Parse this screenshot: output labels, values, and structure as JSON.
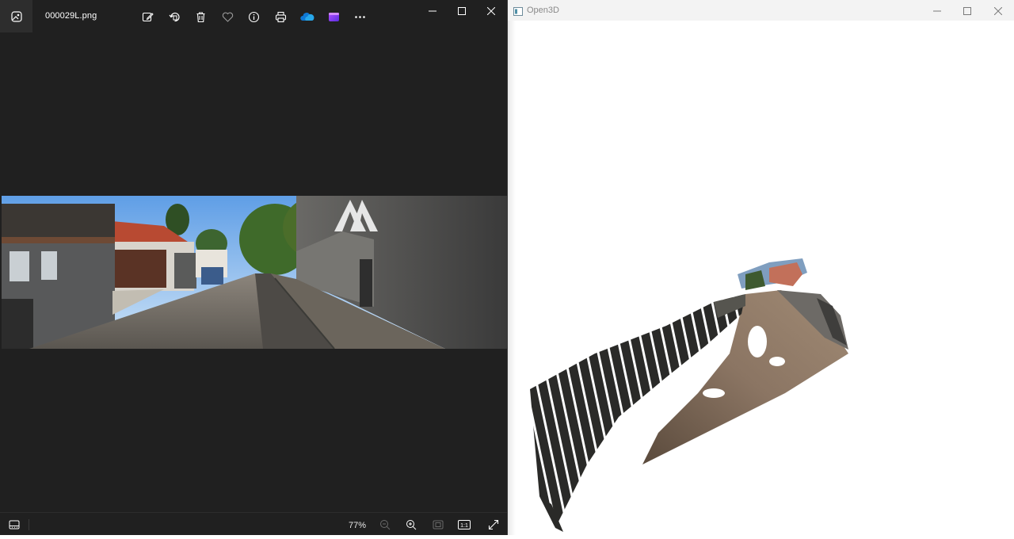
{
  "photos": {
    "filename": "000029L.png",
    "app_icon": "photos-app-icon",
    "toolbar": [
      {
        "name": "edit-image-icon",
        "label": "Edit image"
      },
      {
        "name": "rotate-icon",
        "label": "Rotate"
      },
      {
        "name": "delete-icon",
        "label": "Delete"
      },
      {
        "name": "favorite-icon",
        "label": "Favorite"
      },
      {
        "name": "info-icon",
        "label": "File info"
      },
      {
        "name": "print-icon",
        "label": "Print"
      },
      {
        "name": "onedrive-icon",
        "label": "OneDrive"
      },
      {
        "name": "clipchamp-icon",
        "label": "Clipchamp"
      },
      {
        "name": "more-icon",
        "label": "See more"
      }
    ],
    "status": {
      "zoom": "77%",
      "actual_size_label": "1:1"
    },
    "colors": {
      "background": "#202020",
      "onedrive": "#0f78d4",
      "clipchamp": "#7b3ff2"
    }
  },
  "open3d": {
    "title": "Open3D",
    "background": "#ffffff"
  }
}
